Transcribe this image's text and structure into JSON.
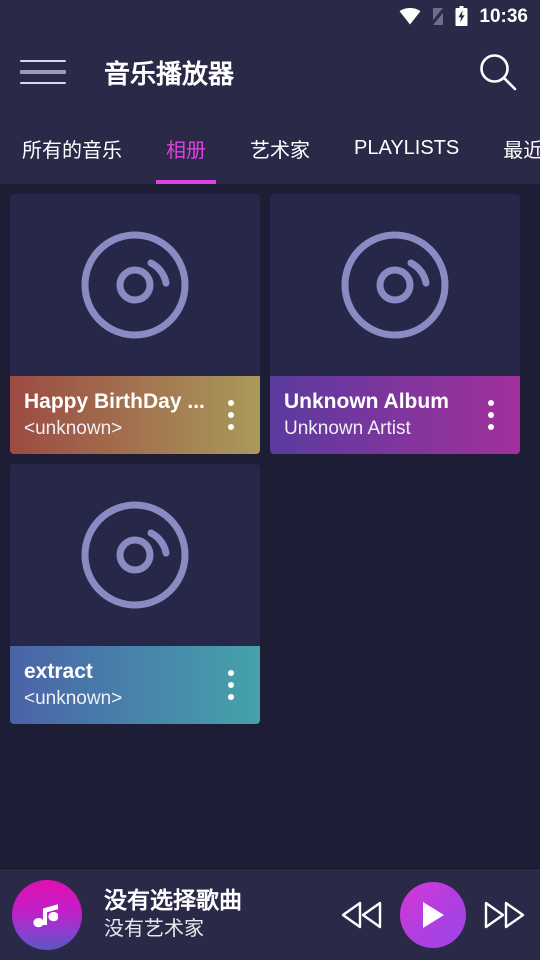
{
  "status_bar": {
    "time": "10:36",
    "icons": [
      "wifi-icon",
      "no-sim-signal-icon",
      "battery-charging-icon"
    ]
  },
  "app_bar": {
    "title": "音乐播放器",
    "menu_icon": "hamburger-menu-icon",
    "search_icon": "search-icon"
  },
  "tabs": [
    {
      "label": "所有的音乐",
      "active": false
    },
    {
      "label": "相册",
      "active": true
    },
    {
      "label": "艺术家",
      "active": false
    },
    {
      "label": "PLAYLISTS",
      "active": false
    },
    {
      "label": "最近播放",
      "active": false
    }
  ],
  "albums": [
    {
      "title": "Happy BirthDay ...",
      "artist": "<unknown>",
      "gradient_from": "#9c4a43",
      "gradient_to": "#a99a5b",
      "art_icon": "disc-icon",
      "overflow_icon": "more-vertical-icon"
    },
    {
      "title": "Unknown Album",
      "artist": "Unknown Artist",
      "gradient_from": "#5a3b9e",
      "gradient_to": "#a2309c",
      "art_icon": "disc-icon",
      "overflow_icon": "more-vertical-icon"
    },
    {
      "title": "extract",
      "artist": "<unknown>",
      "gradient_from": "#4a63a8",
      "gradient_to": "#45a2ab",
      "art_icon": "disc-icon",
      "overflow_icon": "more-vertical-icon"
    }
  ],
  "player": {
    "song_title": "没有选择歌曲",
    "artist_name": "没有艺术家",
    "art_icon": "music-note-icon",
    "previous_icon": "rewind-icon",
    "play_icon": "play-icon",
    "next_icon": "fast-forward-icon"
  },
  "colors": {
    "background": "#1d1d35",
    "surface": "#2a2a48",
    "accent": "#e040e0",
    "disc": "#8b8bc4",
    "text_primary": "#ffffff"
  }
}
